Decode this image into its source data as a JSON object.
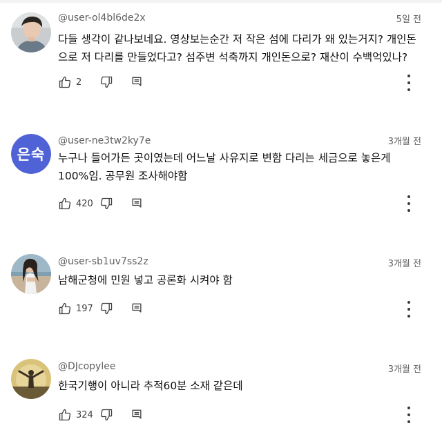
{
  "colors": {
    "author_text": "#606060",
    "body_text": "#0f0f0f",
    "icon": "#404040",
    "avatar_initials_bg": "#4f62d6"
  },
  "comments": [
    {
      "author": "@user-ol4bl6de2x",
      "time": "5일 전",
      "text": "다들 생각이 같나보네요. 영상보는순간 저 작은 섬에 다리가 왜 있는거지? 개인돈으로 저 다리를 만들었다고? 섬주변 석축까지 개인돈으로? 재산이 수백억있나?",
      "likes": "2",
      "avatar": "photo-young-man"
    },
    {
      "author": "@user-ne3tw2ky7e",
      "time": "3개월 전",
      "text": "누구나 들어가든 곳이였는데 어느날 사유지로 변함 다리는 세금으로 놓은게 100%임. 공무원 조사해야함",
      "likes": "420",
      "avatar_initials": "은숙"
    },
    {
      "author": "@user-sb1uv7ss2z",
      "time": "3개월 전",
      "text": "남해군청에 민원 넣고 공론화 시켜야 함",
      "likes": "197",
      "avatar": "photo-woman-beach"
    },
    {
      "author": "@DJcopylee",
      "time": "3개월 전",
      "text": "한국기행이 아니라 추적60분 소재 같은데",
      "likes": "324",
      "avatar": "photo-person-sunset"
    }
  ],
  "icons": {
    "like": "thumb-up-icon",
    "dislike": "thumb-down-icon",
    "reply": "reply-icon",
    "menu": "more-vertical-icon"
  }
}
